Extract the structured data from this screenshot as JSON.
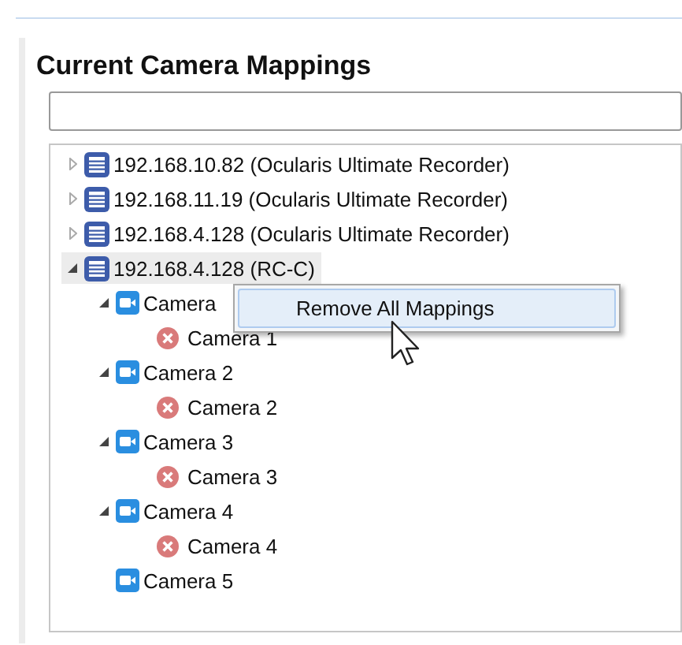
{
  "panel": {
    "title": "Current Camera Mappings"
  },
  "tree": [
    {
      "kind": "recorder",
      "label": "192.168.10.82 (Ocularis Ultimate Recorder)",
      "expanded": false,
      "selected": false
    },
    {
      "kind": "recorder",
      "label": "192.168.11.19 (Ocularis Ultimate Recorder)",
      "expanded": false,
      "selected": false
    },
    {
      "kind": "recorder",
      "label": "192.168.4.128 (Ocularis Ultimate Recorder)",
      "expanded": false,
      "selected": false
    },
    {
      "kind": "recorder",
      "label": "192.168.4.128 (RC-C)",
      "expanded": true,
      "selected": true,
      "children": [
        {
          "kind": "camera",
          "label": "Camera",
          "expanded": true,
          "selected": false,
          "children": [
            {
              "kind": "mapping",
              "label": "Camera 1",
              "selected": false
            }
          ]
        },
        {
          "kind": "camera",
          "label": "Camera 2",
          "expanded": true,
          "selected": false,
          "children": [
            {
              "kind": "mapping",
              "label": "Camera 2",
              "selected": false
            }
          ]
        },
        {
          "kind": "camera",
          "label": "Camera 3",
          "expanded": true,
          "selected": false,
          "children": [
            {
              "kind": "mapping",
              "label": "Camera 3",
              "selected": false
            }
          ]
        },
        {
          "kind": "camera",
          "label": "Camera 4",
          "expanded": true,
          "selected": false,
          "children": [
            {
              "kind": "mapping",
              "label": "Camera 4",
              "selected": false
            }
          ]
        },
        {
          "kind": "camera",
          "label": "Camera 5",
          "selected": false
        }
      ]
    }
  ],
  "context_menu": {
    "items": [
      {
        "label": "Remove All Mappings",
        "selected": true
      }
    ]
  }
}
